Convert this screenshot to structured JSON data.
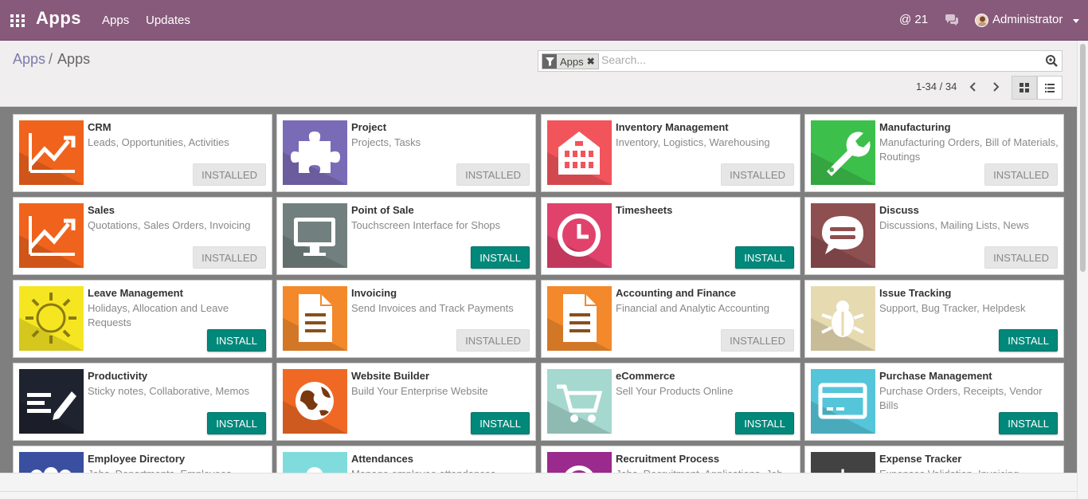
{
  "topbar": {
    "app_name": "Apps",
    "nav": [
      "Apps",
      "Updates"
    ],
    "mentions": "@ 21",
    "user": "Administrator",
    "bg_color": "#875a7b"
  },
  "breadcrumb": {
    "parent": "Apps",
    "separator": "/",
    "current": "Apps"
  },
  "search": {
    "facet": "Apps",
    "placeholder": "Search..."
  },
  "pager": {
    "range": "1-34 / 34"
  },
  "buttons": {
    "installed": "INSTALLED",
    "install": "INSTALL"
  },
  "apps": [
    {
      "title": "CRM",
      "summary": "Leads, Opportunities, Activities",
      "status": "INSTALLED",
      "icon": "chart-trend-icon",
      "color": "#f0631c"
    },
    {
      "title": "Project",
      "summary": "Projects, Tasks",
      "status": "INSTALLED",
      "icon": "puzzle-icon",
      "color": "#7a6bb7"
    },
    {
      "title": "Inventory Management",
      "summary": "Inventory, Logistics, Warehousing",
      "status": "INSTALLED",
      "icon": "warehouse-icon",
      "color": "#f2545b"
    },
    {
      "title": "Manufacturing",
      "summary": "Manufacturing Orders, Bill of Materials, Routings",
      "status": "INSTALLED",
      "icon": "wrench-icon",
      "color": "#3dbf4b"
    },
    {
      "title": "Sales",
      "summary": "Quotations, Sales Orders, Invoicing",
      "status": "INSTALLED",
      "icon": "chart-trend-icon",
      "color": "#f0631c"
    },
    {
      "title": "Point of Sale",
      "summary": "Touchscreen Interface for Shops",
      "status": "INSTALL",
      "icon": "monitor-icon",
      "color": "#71807f"
    },
    {
      "title": "Timesheets",
      "summary": "",
      "status": "INSTALL",
      "icon": "clock-icon",
      "color": "#e0426c"
    },
    {
      "title": "Discuss",
      "summary": "Discussions, Mailing Lists, News",
      "status": "INSTALLED",
      "icon": "chat-bubble-icon",
      "color": "#8e4f51"
    },
    {
      "title": "Leave Management",
      "summary": "Holidays, Allocation and Leave Requests",
      "status": "INSTALL",
      "icon": "sun-icon",
      "color": "#f6e622"
    },
    {
      "title": "Invoicing",
      "summary": "Send Invoices and Track Payments",
      "status": "INSTALLED",
      "icon": "document-icon",
      "color": "#f3892b"
    },
    {
      "title": "Accounting and Finance",
      "summary": "Financial and Analytic Accounting",
      "status": "INSTALLED",
      "icon": "document-icon",
      "color": "#f3892b"
    },
    {
      "title": "Issue Tracking",
      "summary": "Support, Bug Tracker, Helpdesk",
      "status": "INSTALL",
      "icon": "bug-icon",
      "color": "#e6dab0"
    },
    {
      "title": "Productivity",
      "summary": "Sticky notes, Collaborative, Memos",
      "status": "INSTALL",
      "icon": "notes-pen-icon",
      "color": "#1f2330"
    },
    {
      "title": "Website Builder",
      "summary": "Build Your Enterprise Website",
      "status": "INSTALL",
      "icon": "globe-icon",
      "color": "#ef6925"
    },
    {
      "title": "eCommerce",
      "summary": "Sell Your Products Online",
      "status": "INSTALL",
      "icon": "cart-icon",
      "color": "#a5d8cf"
    },
    {
      "title": "Purchase Management",
      "summary": "Purchase Orders, Receipts, Vendor Bills",
      "status": "INSTALL",
      "icon": "credit-card-icon",
      "color": "#55c5da"
    },
    {
      "title": "Employee Directory",
      "summary": "Jobs, Departments, Employees",
      "status": "",
      "icon": "people-icon",
      "color": "#3b4fa0"
    },
    {
      "title": "Attendances",
      "summary": "Manage employee attendances",
      "status": "",
      "icon": "person-icon",
      "color": "#80dcdc"
    },
    {
      "title": "Recruitment Process",
      "summary": "Jobs, Recruitment, Applications, Job",
      "status": "",
      "icon": "search-person-icon",
      "color": "#9a2a8d"
    },
    {
      "title": "Expense Tracker",
      "summary": "Expenses Validation, Invoicing",
      "status": "",
      "icon": "dollar-icon",
      "color": "#424242"
    }
  ]
}
